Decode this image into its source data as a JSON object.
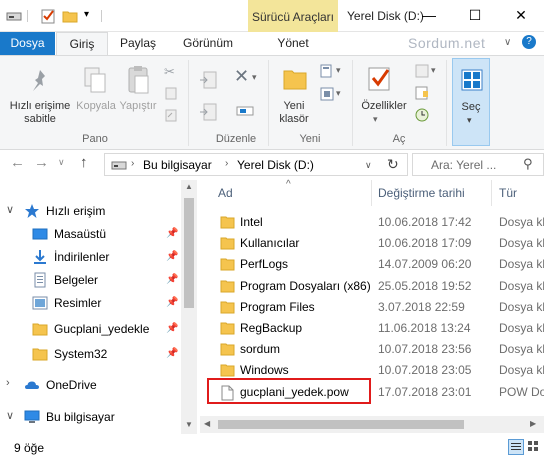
{
  "window": {
    "context_tab": "Sürücü Araçları",
    "title": "Yerel Disk (D:)",
    "controls": {
      "minimize": "—",
      "maximize": "☐",
      "close": "✕"
    }
  },
  "ribbon_tabs": {
    "dosya": "Dosya",
    "giris": "Giriş",
    "paylas": "Paylaş",
    "gorunum": "Görünüm",
    "yonet": "Yönet"
  },
  "brand": "Sordum.net",
  "ribbon": {
    "pin_label_1": "Hızlı erişime",
    "pin_label_2": "sabitle",
    "copy": "Kopyala",
    "paste": "Yapıştır",
    "new_folder_1": "Yeni",
    "new_folder_2": "klasör",
    "properties": "Özellikler",
    "select": "Seç",
    "groups": {
      "pano": "Pano",
      "duzenle": "Düzenle",
      "yeni": "Yeni",
      "ac": "Aç"
    }
  },
  "address": {
    "computer": "Bu bilgisayar",
    "drive": "Yerel Disk (D:)",
    "search_placeholder": "Ara: Yerel ..."
  },
  "sidebar": {
    "quick_access": "Hızlı erişim",
    "items": [
      {
        "label": "Masaüstü"
      },
      {
        "label": "İndirilenler"
      },
      {
        "label": "Belgeler"
      },
      {
        "label": "Resimler"
      },
      {
        "label": "Gucplani_yedekle"
      },
      {
        "label": "System32"
      }
    ],
    "onedrive": "OneDrive",
    "this_pc": "Bu bilgisayar"
  },
  "columns": {
    "name": "Ad",
    "date": "Değiştirme tarihi",
    "type": "Tür"
  },
  "files": [
    {
      "name": "Intel",
      "date": "10.06.2018 17:42",
      "type": "Dosya kl"
    },
    {
      "name": "Kullanıcılar",
      "date": "10.06.2018 17:09",
      "type": "Dosya kl"
    },
    {
      "name": "PerfLogs",
      "date": "14.07.2009 06:20",
      "type": "Dosya kl"
    },
    {
      "name": "Program Dosyaları (x86)",
      "date": "25.05.2018 19:52",
      "type": "Dosya kl"
    },
    {
      "name": "Program Files",
      "date": "3.07.2018 22:59",
      "type": "Dosya kl"
    },
    {
      "name": "RegBackup",
      "date": "11.06.2018 13:24",
      "type": "Dosya kl"
    },
    {
      "name": "sordum",
      "date": "10.07.2018 23:56",
      "type": "Dosya kl"
    },
    {
      "name": "Windows",
      "date": "10.07.2018 23:05",
      "type": "Dosya kl"
    },
    {
      "name": "gucplani_yedek.pow",
      "date": "17.07.2018 23:01",
      "type": "POW Dos"
    }
  ],
  "status": {
    "count": "9 öğe"
  },
  "colors": {
    "accent": "#1979ca",
    "folder": "#f5c44e",
    "context_tab": "#f3e59a",
    "highlight": "#e01b1b"
  }
}
